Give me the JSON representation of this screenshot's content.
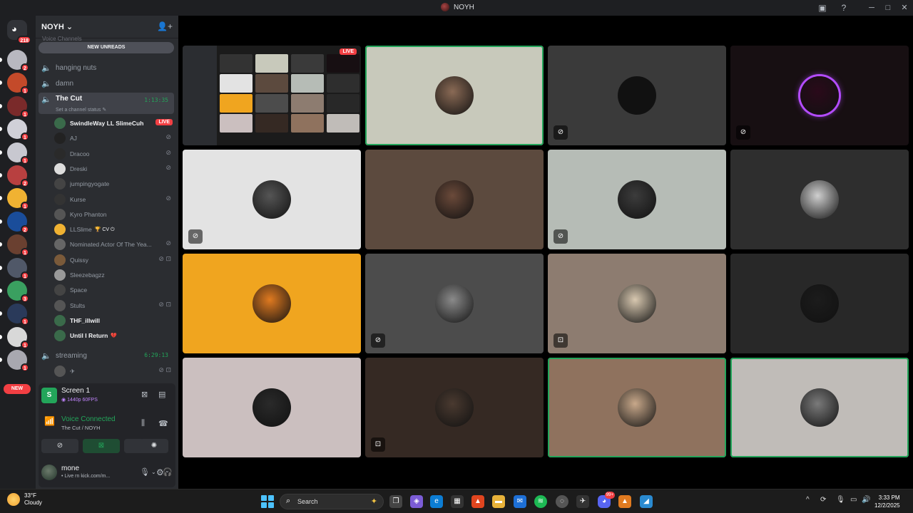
{
  "window": {
    "title": "NOYH"
  },
  "rail": {
    "home_badge": "218",
    "servers": [
      {
        "badge": "2",
        "color": "#b8b8c0"
      },
      {
        "badge": "1",
        "color": "#c44a2a"
      },
      {
        "badge": "1",
        "color": "#7a2a2a"
      },
      {
        "badge": "1",
        "color": "#d0d0d8"
      },
      {
        "badge": "1",
        "color": "#c8c8d0"
      },
      {
        "badge": "2",
        "color": "#b84040"
      },
      {
        "badge": "1",
        "color": "#f0b232"
      },
      {
        "badge": "2",
        "color": "#1a4d9a"
      },
      {
        "badge": "1",
        "color": "#6a4030"
      },
      {
        "badge": "1",
        "color": "#505868"
      },
      {
        "badge": "3",
        "color": "#3aa060"
      },
      {
        "badge": "1",
        "color": "#2a3a5a"
      },
      {
        "badge": "1",
        "color": "#d8d8d8"
      },
      {
        "badge": "1",
        "color": "#a8a8b0"
      }
    ],
    "new_label": "NEW"
  },
  "guild": {
    "name": "NOYH",
    "faded_category": "Voice Channels",
    "new_unreads": "NEW UNREADS",
    "channels": [
      {
        "name": "hanging nuts"
      },
      {
        "name": "damn"
      }
    ],
    "active_channel": {
      "name": "The Cut",
      "timer": "1:13:35",
      "status": "Set a channel status"
    },
    "members": [
      {
        "name": "SwindleWay LL SlimeCuh",
        "bright": true,
        "live": "LIVE",
        "icons": "",
        "color": "#3a6a4a"
      },
      {
        "name": "AJ",
        "bright": false,
        "icons": "⊘",
        "color": "#222"
      },
      {
        "name": "Dracoo",
        "bright": false,
        "icons": "⊘",
        "color": "#2a2a2a"
      },
      {
        "name": "Dreski",
        "bright": false,
        "icons": "⊘",
        "color": "#ddd"
      },
      {
        "name": "jumpingyogate",
        "bright": false,
        "icons": "",
        "color": "#444"
      },
      {
        "name": "Kurse",
        "bright": false,
        "icons": "⊘",
        "color": "#333"
      },
      {
        "name": "Kyro Phanton",
        "bright": false,
        "icons": "",
        "color": "#555"
      },
      {
        "name": "LLSlime",
        "bright": false,
        "icons": "",
        "color": "#f0b232",
        "extra": "🏆 CV ⏻"
      },
      {
        "name": "Nominated Actor Of The Yea...",
        "bright": false,
        "icons": "⊘",
        "color": "#666"
      },
      {
        "name": "Quissy",
        "bright": false,
        "icons": "⊘ ⊡",
        "color": "#7a5a3a"
      },
      {
        "name": "Sleezebagzz",
        "bright": false,
        "icons": "",
        "color": "#999"
      },
      {
        "name": "Space",
        "bright": false,
        "icons": "",
        "color": "#444"
      },
      {
        "name": "Stults",
        "bright": false,
        "icons": "⊘ ⊡",
        "color": "#555"
      },
      {
        "name": "THF_illwill",
        "bright": true,
        "icons": "",
        "color": "#3a6a4a"
      },
      {
        "name": "Until I Return",
        "bright": true,
        "icons": "",
        "color": "#3a6a4a",
        "extra": "💔"
      }
    ],
    "streaming_channel": {
      "name": "streaming",
      "timer": "6:29:13"
    },
    "streaming_member": {
      "name": "✈",
      "icons": "⊘ ⊡"
    }
  },
  "stream_panel": {
    "title": "Screen 1",
    "sub": "1440p 60FPS"
  },
  "voice_panel": {
    "title": "Voice Connected",
    "sub": "The Cut / NOYH"
  },
  "user_panel": {
    "name": "mone",
    "status": "• Live rn kick.com/m..."
  },
  "tiles": [
    {
      "kind": "screen",
      "bg": "#1b1b1b",
      "live": "LIVE",
      "speaking": false,
      "badge": ""
    },
    {
      "kind": "avatar",
      "bg": "#c8c9bb",
      "avatar": "#8a6a55",
      "speaking": true,
      "badge": ""
    },
    {
      "kind": "avatar",
      "bg": "#3a3a3a",
      "avatar": "#111111",
      "speaking": false,
      "badge": "⊘"
    },
    {
      "kind": "avatar",
      "bg": "#170f12",
      "avatar": "#2a0a1a",
      "speaking": false,
      "badge": "⊘",
      "ring": "#b44cff"
    },
    {
      "kind": "avatar",
      "bg": "#e3e3e3",
      "avatar": "#555555",
      "speaking": false,
      "badge": "⊘"
    },
    {
      "kind": "avatar",
      "bg": "#5c4a3e",
      "avatar": "#6b4a3a",
      "speaking": false,
      "badge": ""
    },
    {
      "kind": "avatar",
      "bg": "#b6bcb6",
      "avatar": "#3c3c3c",
      "speaking": false,
      "badge": "⊘"
    },
    {
      "kind": "avatar",
      "bg": "#2e2e2e",
      "avatar": "#cfcfcf",
      "speaking": false,
      "badge": ""
    },
    {
      "kind": "avatar",
      "bg": "#f0a51f",
      "avatar": "#e07a20",
      "speaking": false,
      "badge": ""
    },
    {
      "kind": "avatar",
      "bg": "#4c4c4c",
      "avatar": "#8a8a8a",
      "speaking": false,
      "badge": "⊘"
    },
    {
      "kind": "avatar",
      "bg": "#8d7c70",
      "avatar": "#d8c8b0",
      "speaking": false,
      "badge": "⊡"
    },
    {
      "kind": "avatar",
      "bg": "#282828",
      "avatar": "#1c1c1c",
      "speaking": false,
      "badge": ""
    },
    {
      "kind": "avatar",
      "bg": "#cbbfbf",
      "avatar": "#2a2a2a",
      "speaking": false,
      "badge": ""
    },
    {
      "kind": "avatar",
      "bg": "#352923",
      "avatar": "#4a3a30",
      "speaking": false,
      "badge": "⊡"
    },
    {
      "kind": "avatar",
      "bg": "#8f725e",
      "avatar": "#c8a88a",
      "speaking": true,
      "badge": ""
    },
    {
      "kind": "avatar",
      "bg": "#c0bcb8",
      "avatar": "#7a7a7a",
      "speaking": true,
      "badge": ""
    }
  ],
  "taskbar": {
    "temp": "33°F",
    "condition": "Cloudy",
    "search": "Search",
    "time": "3:33 PM",
    "date": "12/2/2025",
    "discord_badge": "99+"
  }
}
